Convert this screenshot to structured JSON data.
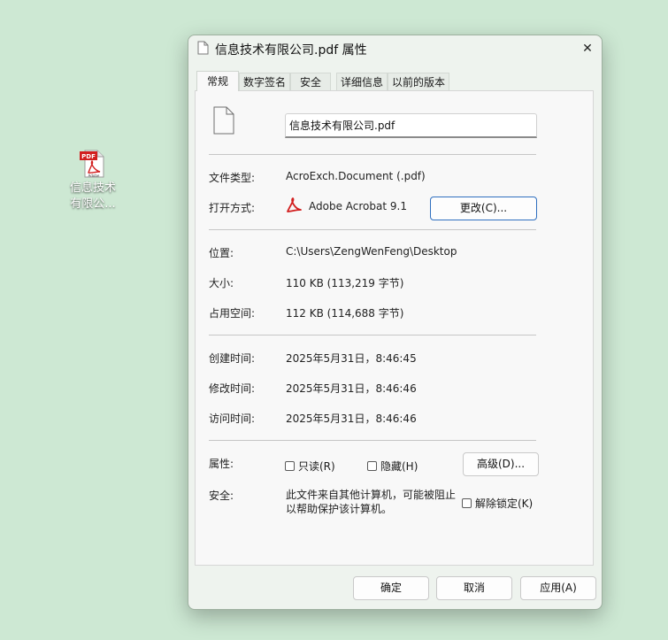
{
  "desktop": {
    "icon_label": "信息技术\n有限公..."
  },
  "window": {
    "title": "信息技术有限公司.pdf 属性",
    "close_glyph": "✕"
  },
  "tabs": [
    {
      "label": "常规",
      "active": true
    },
    {
      "label": "数字签名",
      "active": false
    },
    {
      "label": "安全",
      "active": false
    },
    {
      "label": "详细信息",
      "active": false
    },
    {
      "label": "以前的版本",
      "active": false
    }
  ],
  "general": {
    "file_name": "信息技术有限公司.pdf",
    "file_type_label": "文件类型:",
    "file_type_value": "AcroExch.Document (.pdf)",
    "open_with_label": "打开方式:",
    "open_with_value": "Adobe Acrobat 9.1",
    "change_button": "更改(C)...",
    "location_label": "位置:",
    "location_value": "C:\\Users\\ZengWenFeng\\Desktop",
    "size_label": "大小:",
    "size_value": "110 KB (113,219 字节)",
    "size_on_disk_label": "占用空间:",
    "size_on_disk_value": "112 KB (114,688 字节)",
    "created_label": "创建时间:",
    "created_value": "2025年5月31日，8:46:45",
    "modified_label": "修改时间:",
    "modified_value": "2025年5月31日，8:46:46",
    "accessed_label": "访问时间:",
    "accessed_value": "2025年5月31日，8:46:46",
    "attributes_label": "属性:",
    "readonly_label": "只读(R)",
    "hidden_label": "隐藏(H)",
    "advanced_button": "高级(D)...",
    "security_label": "安全:",
    "security_text_line1": "此文件来自其他计算机，可能被阻止",
    "security_text_line2": "以帮助保护该计算机。",
    "unblock_label": "解除锁定(K)"
  },
  "footer": {
    "ok": "确定",
    "cancel": "取消",
    "apply": "应用(A)"
  },
  "colors": {
    "desktop_bg": "#cde8d3",
    "window_bg": "#eef3ee",
    "accent_border": "#2f6fbf",
    "pdf_red": "#d21f1f"
  }
}
